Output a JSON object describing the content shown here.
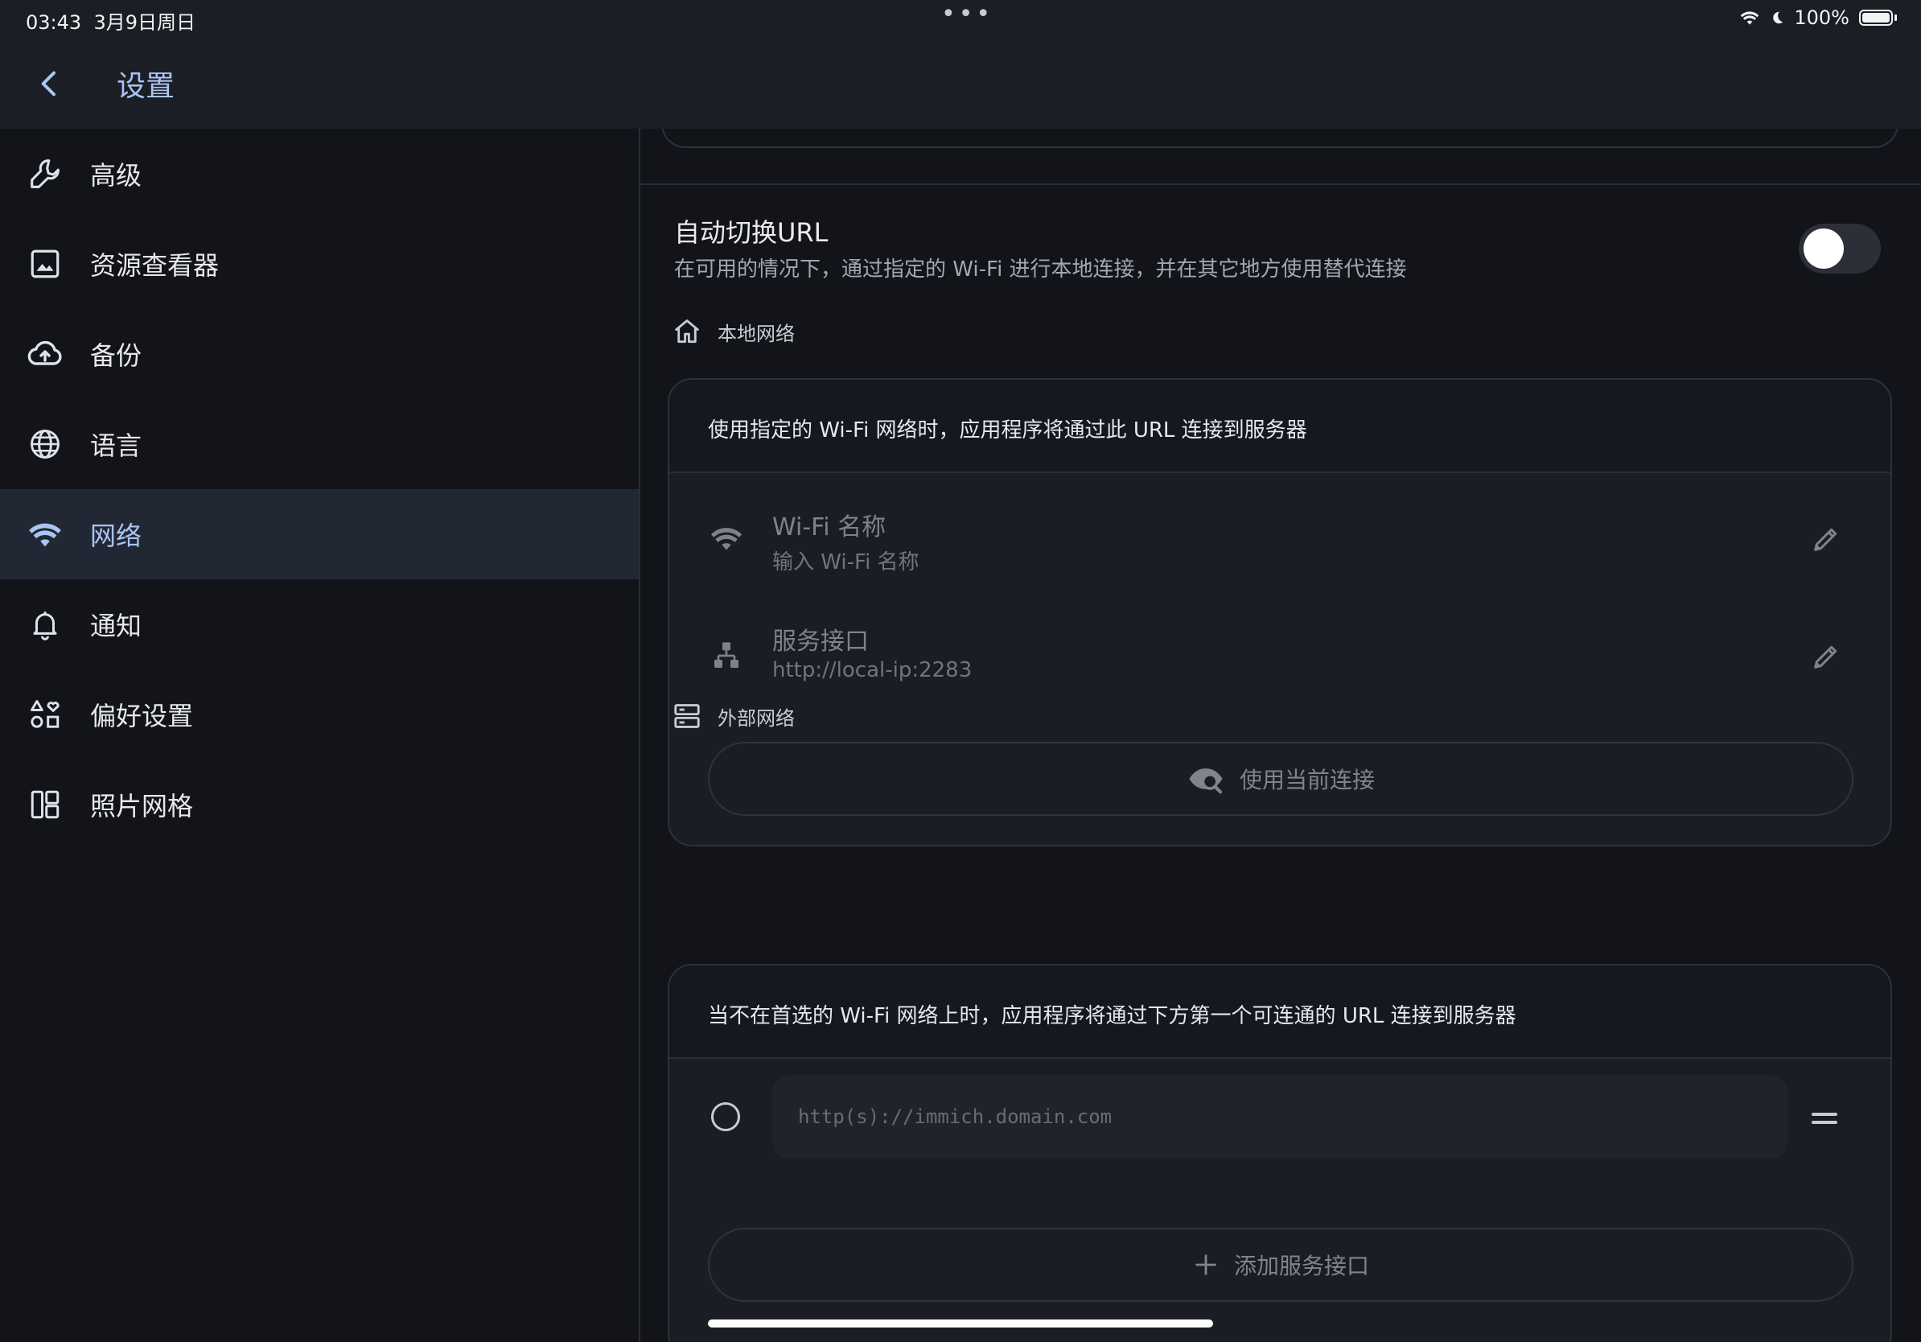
{
  "status_bar": {
    "time": "03:43",
    "date": "3月9日周日",
    "battery": "100%"
  },
  "app_bar": {
    "title": "设置"
  },
  "sidebar": {
    "items": [
      {
        "label": "高级",
        "icon": "wrench-icon"
      },
      {
        "label": "资源查看器",
        "icon": "image-icon"
      },
      {
        "label": "备份",
        "icon": "cloud-upload-icon"
      },
      {
        "label": "语言",
        "icon": "globe-icon"
      },
      {
        "label": "网络",
        "icon": "wifi-icon",
        "active": true
      },
      {
        "label": "通知",
        "icon": "bell-icon"
      },
      {
        "label": "偏好设置",
        "icon": "shapes-icon"
      },
      {
        "label": "照片网格",
        "icon": "grid-layout-icon"
      }
    ]
  },
  "auto_switch": {
    "title": "自动切换URL",
    "subtitle": "在可用的情况下，通过指定的 Wi-Fi 进行本地连接，并在其它地方使用替代连接",
    "enabled": false
  },
  "local_network": {
    "header": "本地网络",
    "description": "使用指定的 Wi-Fi 网络时，应用程序将通过此 URL 连接到服务器",
    "wifi_name": {
      "title": "Wi-Fi 名称",
      "placeholder": "输入 Wi-Fi 名称"
    },
    "server_endpoint": {
      "title": "服务接口",
      "value": "http://local-ip:2283"
    },
    "use_current_button": "使用当前连接"
  },
  "external_network": {
    "header": "外部网络",
    "description": "当不在首选的 Wi-Fi 网络上时，应用程序将通过下方第一个可连通的 URL 连接到服务器",
    "url_placeholder": "http(s)://immich.domain.com",
    "add_button": "添加服务接口"
  },
  "colors": {
    "accent": "#a9c4f5",
    "background": "#12141a",
    "active_nav": "#222833"
  }
}
